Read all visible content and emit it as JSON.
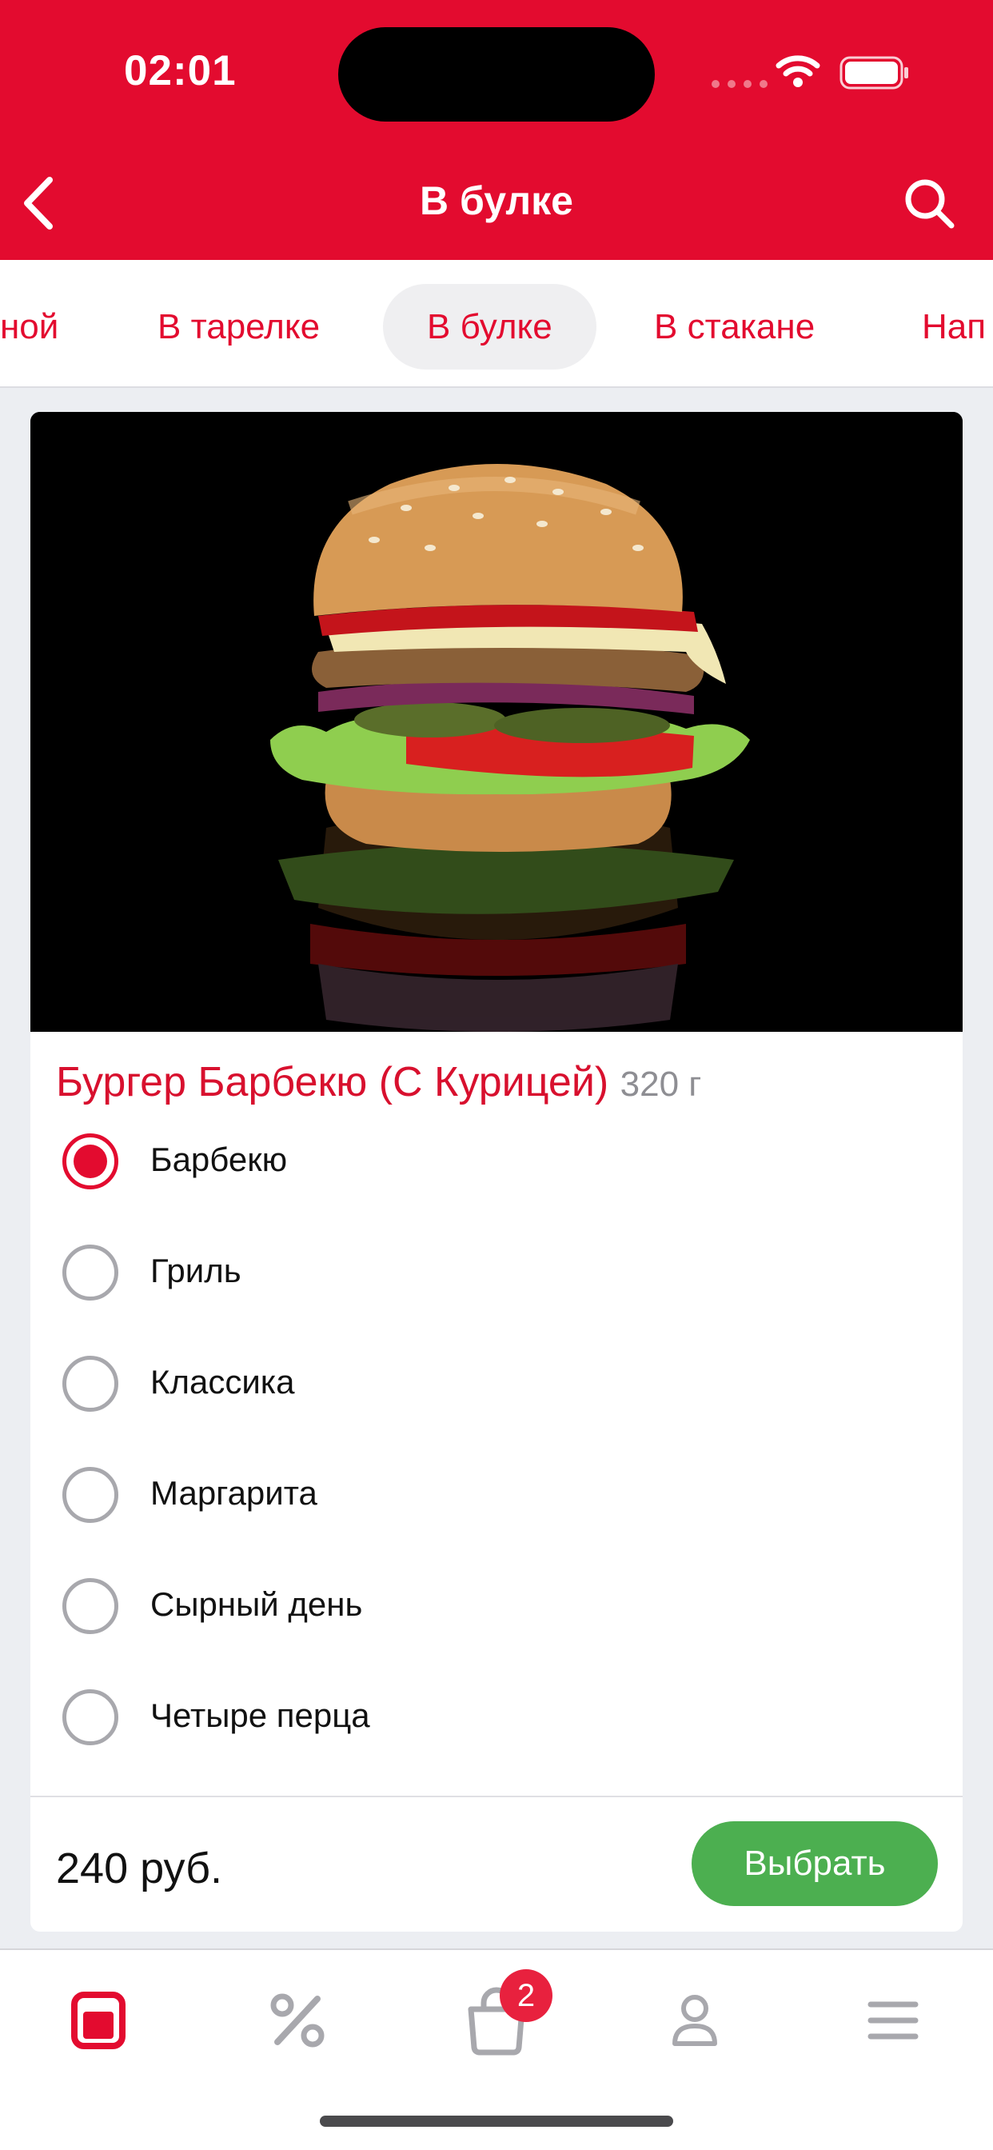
{
  "status_bar": {
    "time": "02:01"
  },
  "nav": {
    "title": "В булке"
  },
  "tabs": [
    {
      "label": "ной"
    },
    {
      "label": "В тарелке"
    },
    {
      "label": "В булке",
      "active": true
    },
    {
      "label": "В стакане"
    },
    {
      "label": "Нап"
    }
  ],
  "product": {
    "name": "Бургер Барбекю (С Курицей)",
    "weight": "320 г",
    "options": [
      {
        "label": "Барбекю",
        "selected": true
      },
      {
        "label": "Гриль",
        "selected": false
      },
      {
        "label": "Классика",
        "selected": false
      },
      {
        "label": "Маргарита",
        "selected": false
      },
      {
        "label": "Сырный день",
        "selected": false
      },
      {
        "label": "Четыре перца",
        "selected": false
      }
    ],
    "price": "240 руб.",
    "select_label": "Выбрать"
  },
  "tabbar": {
    "items": [
      {
        "icon": "menu-card-icon",
        "active": true
      },
      {
        "icon": "percent-icon",
        "active": false
      },
      {
        "icon": "bag-icon",
        "active": false
      },
      {
        "icon": "profile-icon",
        "active": false
      },
      {
        "icon": "hamburger-menu-icon",
        "active": false
      }
    ],
    "cart_badge": "2"
  },
  "colors": {
    "brand_red": "#e30b2f",
    "select_green": "#4caf50",
    "inactive_icon": "#a8a8ad"
  }
}
